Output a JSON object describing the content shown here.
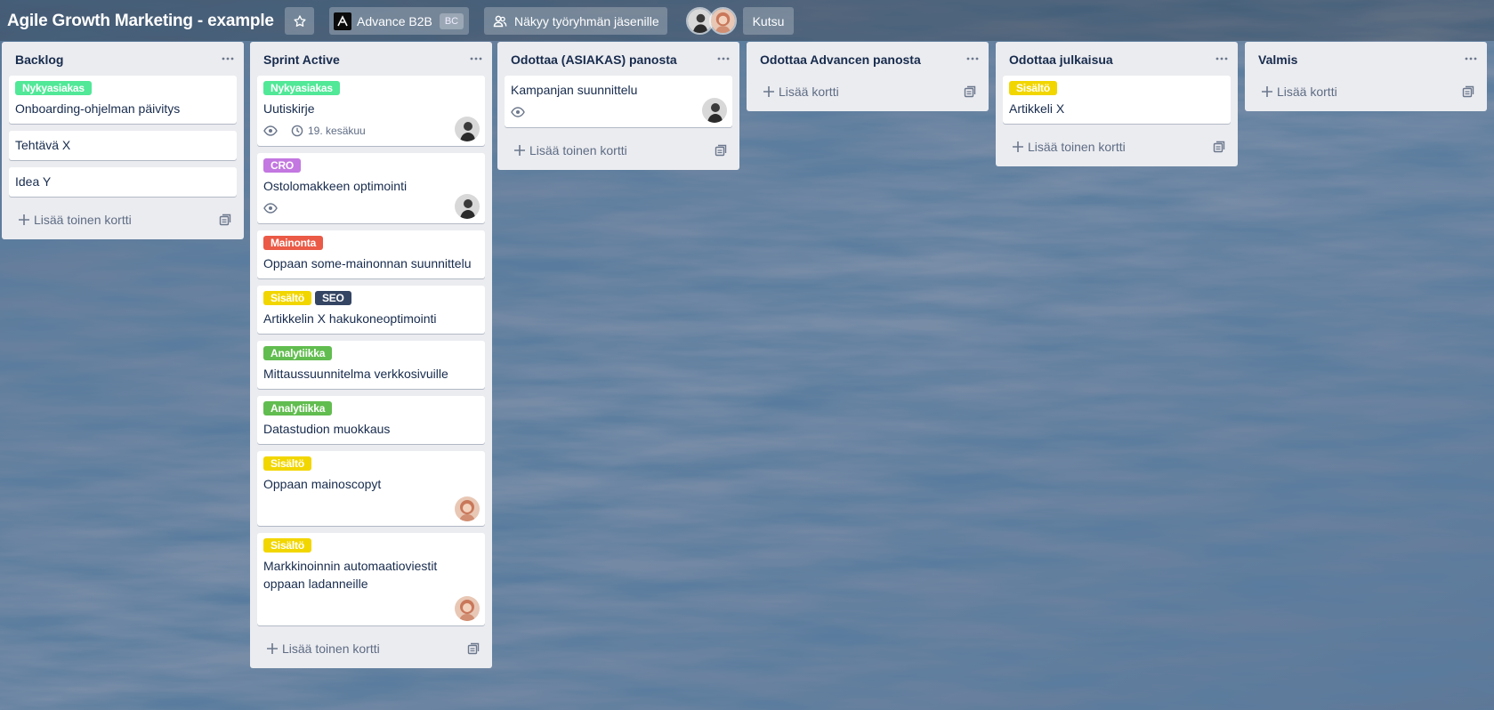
{
  "board": {
    "title": "Agile Growth Marketing - example",
    "organization": "Advance B2B",
    "organization_badge": "BC",
    "visibility": "Näkyy työryhmän jäsenille",
    "invite_label": "Kutsu"
  },
  "colors": {
    "green": "#61bd4f",
    "mint": "#51e898",
    "purple": "#c377e0",
    "red": "#eb5a46",
    "yellow": "#f2d600",
    "navy": "#344563"
  },
  "lists": [
    {
      "title": "Backlog",
      "add_label": "Lisää toinen kortti",
      "cards": [
        {
          "labels": [
            {
              "text": "Nykyasiakas",
              "color": "mint"
            }
          ],
          "title": "Onboarding-ohjelman päivitys"
        },
        {
          "labels": [],
          "title": "Tehtävä X"
        },
        {
          "labels": [],
          "title": "Idea Y"
        }
      ]
    },
    {
      "title": "Sprint Active",
      "add_label": "Lisää toinen kortti",
      "cards": [
        {
          "labels": [
            {
              "text": "Nykyasiakas",
              "color": "mint"
            }
          ],
          "title": "Uutiskirje",
          "watch": true,
          "due": "19. kesäkuu",
          "avatar": "man"
        },
        {
          "labels": [
            {
              "text": "CRO",
              "color": "purple"
            }
          ],
          "title": "Ostolomakkeen optimointi",
          "watch": true,
          "avatar": "man"
        },
        {
          "labels": [
            {
              "text": "Mainonta",
              "color": "red"
            }
          ],
          "title": "Oppaan some-mainonnan suunnittelu"
        },
        {
          "labels": [
            {
              "text": "Sisältö",
              "color": "yellow"
            },
            {
              "text": "SEO",
              "color": "navy"
            }
          ],
          "title": "Artikkelin X hakukoneoptimointi"
        },
        {
          "labels": [
            {
              "text": "Analytiikka",
              "color": "green"
            }
          ],
          "title": "Mittaussuunnitelma verkkosivuille"
        },
        {
          "labels": [
            {
              "text": "Analytiikka",
              "color": "green"
            }
          ],
          "title": "Datastudion muokkaus"
        },
        {
          "labels": [
            {
              "text": "Sisältö",
              "color": "yellow"
            }
          ],
          "title": "Oppaan mainoscopyt",
          "avatar": "woman"
        },
        {
          "labels": [
            {
              "text": "Sisältö",
              "color": "yellow"
            }
          ],
          "title": "Markkinoinnin automaatioviestit oppaan ladanneille",
          "avatar": "woman"
        }
      ]
    },
    {
      "title": "Odottaa (ASIAKAS) panosta",
      "add_label": "Lisää toinen kortti",
      "cards": [
        {
          "labels": [],
          "title": "Kampanjan suunnittelu",
          "watch": true,
          "avatar": "man"
        }
      ]
    },
    {
      "title": "Odottaa Advancen panosta",
      "add_label": "Lisää kortti",
      "cards": []
    },
    {
      "title": "Odottaa julkaisua",
      "add_label": "Lisää toinen kortti",
      "cards": [
        {
          "labels": [
            {
              "text": "Sisältö",
              "color": "yellow"
            }
          ],
          "title": "Artikkeli X"
        }
      ]
    },
    {
      "title": "Valmis",
      "add_label": "Lisää kortti",
      "cards": []
    }
  ]
}
